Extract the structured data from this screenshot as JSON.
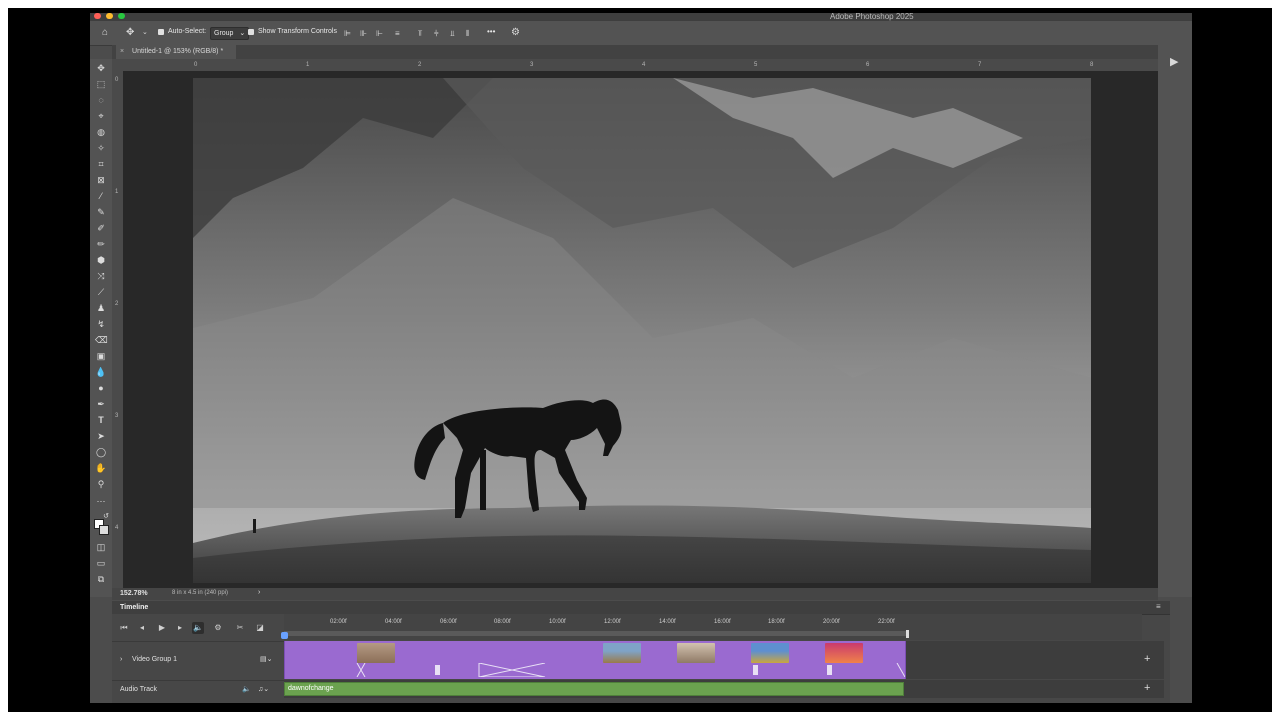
{
  "window": {
    "title": "Adobe Photoshop 2025"
  },
  "options": {
    "auto_select_label": "Auto-Select:",
    "auto_select_value": "Group",
    "show_transform_label": "Show Transform Controls",
    "more_label": "•••"
  },
  "document": {
    "tab_title": "Untitled-1 @ 153% (RGB/8) *",
    "close_glyph": "×"
  },
  "rulers": {
    "h": [
      "0",
      "1",
      "2",
      "3",
      "4",
      "5",
      "6",
      "7",
      "8"
    ],
    "v": [
      "0",
      "1",
      "2",
      "3",
      "4"
    ]
  },
  "status": {
    "zoom": "152.78%",
    "doc_info": "8 in x 4.5 in (240 ppi)",
    "arrow": "›"
  },
  "timeline": {
    "title": "Timeline",
    "ticks": [
      "02:00f",
      "04:00f",
      "06:00f",
      "08:00f",
      "10:00f",
      "12:00f",
      "14:00f",
      "16:00f",
      "18:00f",
      "20:00f",
      "22:00f"
    ],
    "video_group": "Video Group 1",
    "audio_track": "Audio Track",
    "audio_clip": "dawnofchange",
    "add_glyph": "+"
  },
  "colors": {
    "clip": "#9a6ad0",
    "audio": "#6ba24f",
    "playhead": "#69a1ff"
  }
}
